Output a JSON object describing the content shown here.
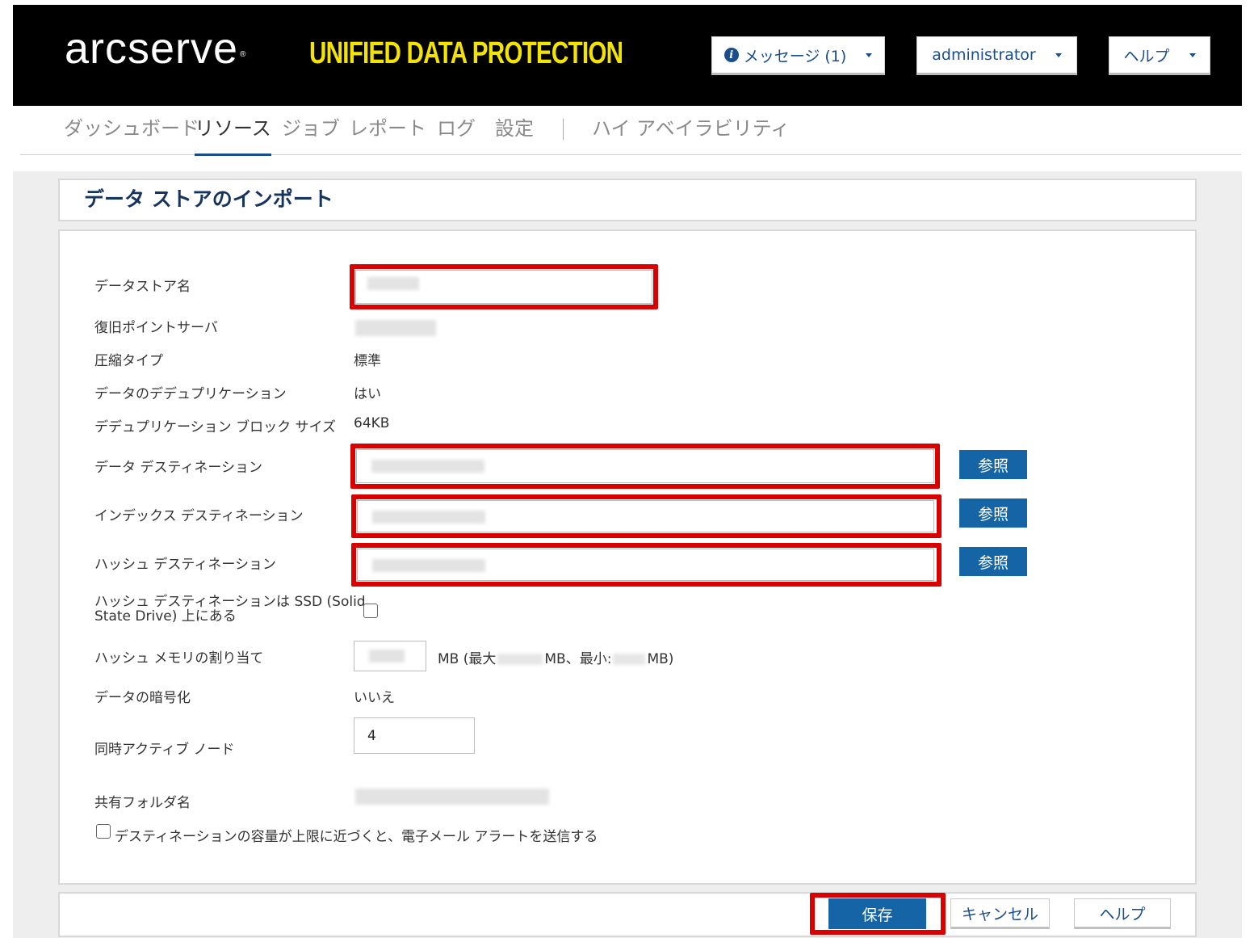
{
  "header": {
    "logo_text": "arcserve",
    "logo_mark": "®",
    "product_name": "UNIFIED DATA PROTECTION",
    "messages_label": "メッセージ (1)",
    "user_label": "administrator",
    "help_label": "ヘルプ",
    "icons": {
      "info": "info-icon",
      "caret": "chevron-down-icon"
    },
    "colors": {
      "background": "#000000",
      "product": "#f2e400",
      "button_text": "#1a4d8c"
    }
  },
  "nav": {
    "items": [
      {
        "label": "ダッシュボード",
        "active": false
      },
      {
        "label": "リソース",
        "active": true
      },
      {
        "label": "ジョブ",
        "active": false
      },
      {
        "label": "レポート",
        "active": false
      },
      {
        "label": "ログ",
        "active": false
      },
      {
        "label": "設定",
        "active": false
      },
      {
        "label": "ハイ アベイラビリティ",
        "active": false
      }
    ]
  },
  "page": {
    "title": "データ ストアのインポート"
  },
  "form": {
    "datastore_name_label": "データストア名",
    "rps_label": "復旧ポイントサーバ",
    "compression_label": "圧縮タイプ",
    "compression_value": "標準",
    "dedup_label": "データのデデュプリケーション",
    "dedup_value": "はい",
    "block_size_label": "デデュプリケーション ブロック サイズ",
    "block_size_value": "64KB",
    "data_dest_label": "データ デスティネーション",
    "index_dest_label": "インデックス デスティネーション",
    "hash_dest_label": "ハッシュ デスティネーション",
    "browse_label": "参照",
    "ssd_label_line1": "ハッシュ デスティネーションは SSD (Solid",
    "ssd_label_line2": "State Drive) 上にある",
    "hash_memory_label": "ハッシュ メモリの割り当て",
    "hash_memory_prefix": "MB (最大",
    "hash_memory_mid": "MB、最小:",
    "hash_memory_suffix": "MB)",
    "encryption_label": "データの暗号化",
    "encryption_value": "いいえ",
    "concurrent_label": "同時アクティブ ノード",
    "concurrent_value": "4",
    "shared_folder_label": "共有フォルダ名",
    "email_alert_label": "デスティネーションの容量が上限に近づくと、電子メール アラートを送信する"
  },
  "footer": {
    "save_label": "保存",
    "cancel_label": "キャンセル",
    "help_label": "ヘルプ"
  },
  "colors": {
    "accent": "#1565a6",
    "highlight": "#d90000",
    "title": "#17345f"
  }
}
